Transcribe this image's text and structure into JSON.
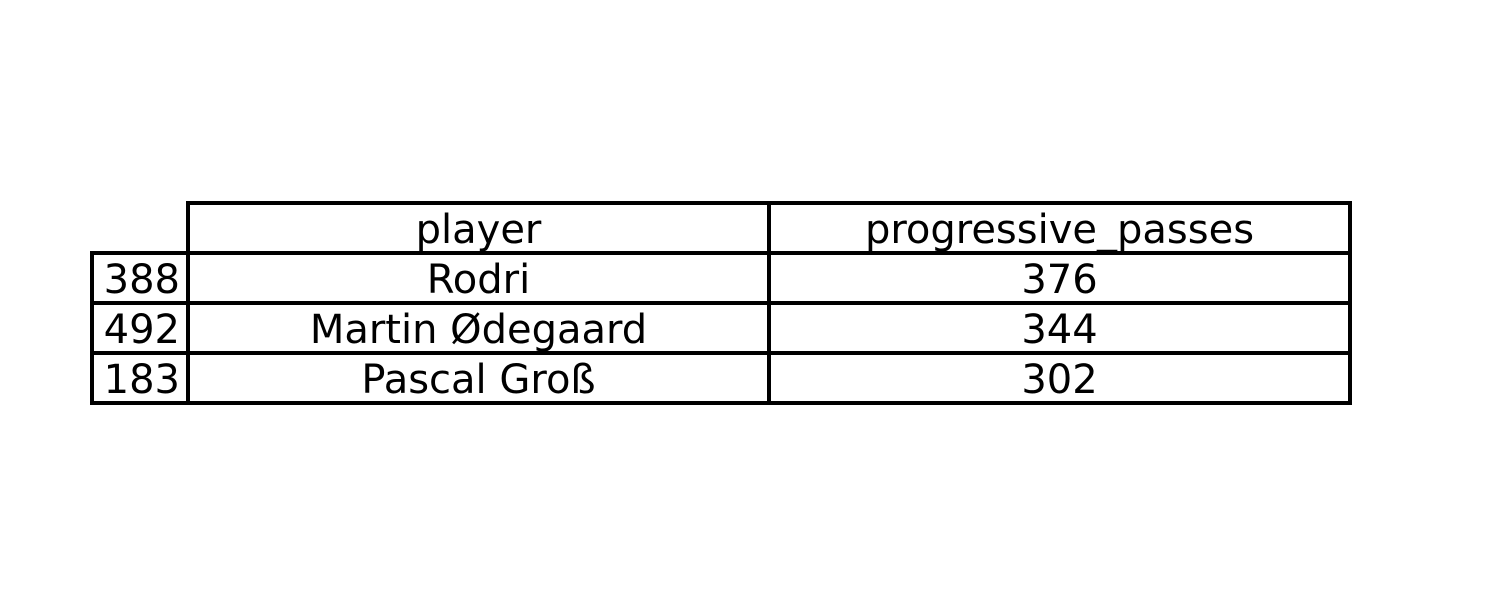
{
  "chart_data": {
    "type": "table",
    "columns": [
      "player",
      "progressive_passes"
    ],
    "rows": [
      {
        "index": "388",
        "cells": [
          "Rodri",
          "376"
        ]
      },
      {
        "index": "492",
        "cells": [
          "Martin Ødegaard",
          "344"
        ]
      },
      {
        "index": "183",
        "cells": [
          "Pascal Groß",
          "302"
        ]
      }
    ]
  }
}
